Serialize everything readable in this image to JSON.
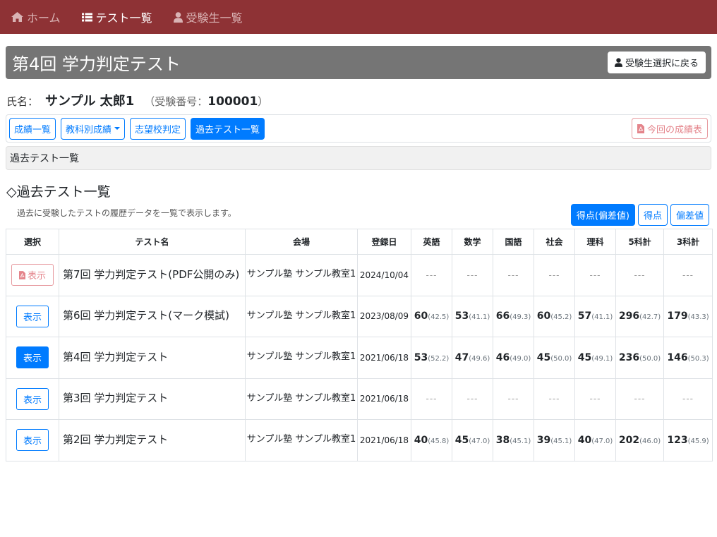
{
  "nav": {
    "home": "ホーム",
    "tests": "テスト一覧",
    "students": "受験生一覧"
  },
  "header": {
    "title": "第4回 学力判定テスト",
    "back_label": "受験生選択に戻る"
  },
  "student": {
    "name_label": "氏名：",
    "name": "サンプル 太郎1",
    "exam_open": "（受験番号：",
    "exam_no": "100001",
    "exam_close": "）"
  },
  "tabs": {
    "results": "成績一覧",
    "by_subject": "教科別成績",
    "school": "志望校判定",
    "past": "過去テスト一覧",
    "pdf": "今回の成績表"
  },
  "breadcrumb": "過去テスト一覧",
  "section": {
    "title": "◇過去テスト一覧",
    "desc": "過去に受験したテストの履歴データを一覧で表示します。"
  },
  "modes": {
    "both": "得点(偏差値)",
    "score": "得点",
    "dev": "偏差値"
  },
  "table": {
    "headers": [
      "選択",
      "テスト名",
      "会場",
      "登録日",
      "英語",
      "数学",
      "国語",
      "社会",
      "理科",
      "5科計",
      "3科計"
    ],
    "rows": [
      {
        "btn": "表示",
        "name": "第7回 学力判定テスト(PDF公開のみ)",
        "venue": "サンプル塾 サンプル教室1",
        "date": "2024/10/04",
        "scores": [
          "---",
          "---",
          "---",
          "---",
          "---",
          "---",
          "---"
        ]
      },
      {
        "btn": "表示",
        "name": "第6回 学力判定テスト(マーク模試)",
        "venue": "サンプル塾 サンプル教室1",
        "date": "2023/08/09",
        "scores": [
          {
            "s": "60",
            "d": "(42.5)"
          },
          {
            "s": "53",
            "d": "(41.1)"
          },
          {
            "s": "66",
            "d": "(49.3)"
          },
          {
            "s": "60",
            "d": "(45.2)"
          },
          {
            "s": "57",
            "d": "(41.1)"
          },
          {
            "s": "296",
            "d": "(42.7)"
          },
          {
            "s": "179",
            "d": "(43.3)"
          }
        ]
      },
      {
        "btn": "表示",
        "name": "第4回 学力判定テスト",
        "venue": "サンプル塾 サンプル教室1",
        "date": "2021/06/18",
        "scores": [
          {
            "s": "53",
            "d": "(52.2)"
          },
          {
            "s": "47",
            "d": "(49.6)"
          },
          {
            "s": "46",
            "d": "(49.0)"
          },
          {
            "s": "45",
            "d": "(50.0)"
          },
          {
            "s": "45",
            "d": "(49.1)"
          },
          {
            "s": "236",
            "d": "(50.0)"
          },
          {
            "s": "146",
            "d": "(50.3)"
          }
        ]
      },
      {
        "btn": "表示",
        "name": "第3回 学力判定テスト",
        "venue": "サンプル塾 サンプル教室1",
        "date": "2021/06/18",
        "scores": [
          "---",
          "---",
          "---",
          "---",
          "---",
          "---",
          "---"
        ]
      },
      {
        "btn": "表示",
        "name": "第2回 学力判定テスト",
        "venue": "サンプル塾 サンプル教室1",
        "date": "2021/06/18",
        "scores": [
          {
            "s": "40",
            "d": "(45.8)"
          },
          {
            "s": "45",
            "d": "(47.0)"
          },
          {
            "s": "38",
            "d": "(45.1)"
          },
          {
            "s": "39",
            "d": "(45.1)"
          },
          {
            "s": "40",
            "d": "(47.0)"
          },
          {
            "s": "202",
            "d": "(46.0)"
          },
          {
            "s": "123",
            "d": "(45.9)"
          }
        ]
      }
    ]
  },
  "colors": {
    "navbar": "#8e3235",
    "primary": "#007bff",
    "title_bar": "#757575",
    "pdf": "#e4848b"
  }
}
